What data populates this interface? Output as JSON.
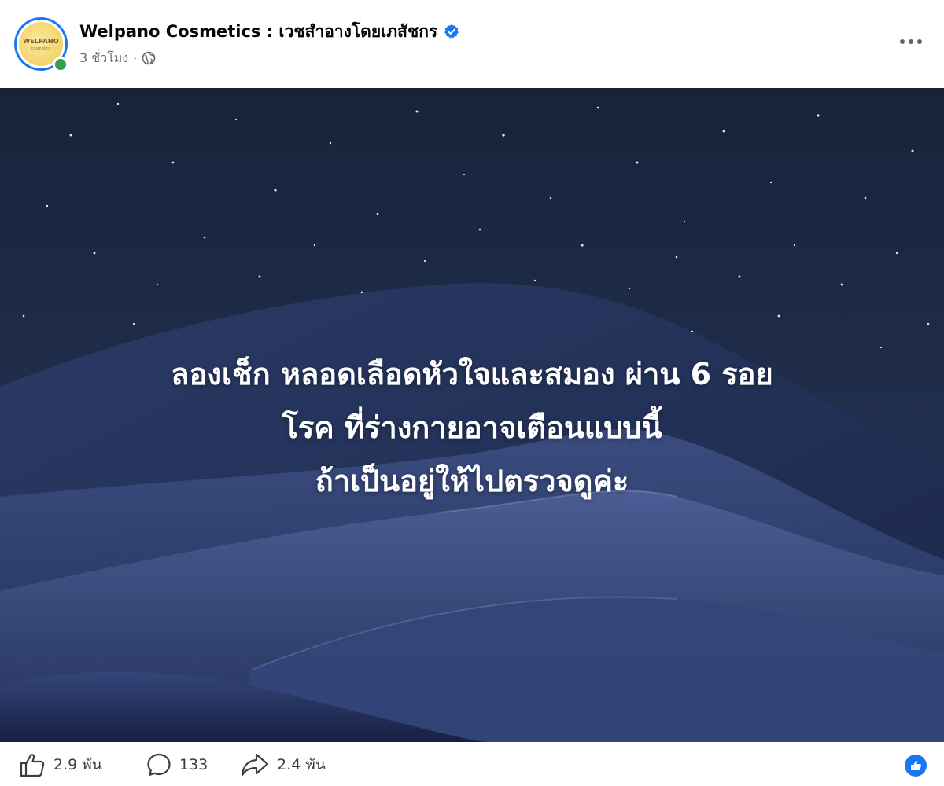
{
  "post": {
    "page_name": "Welpano Cosmetics : เวชสำอางโดยเภสัชกร",
    "avatar_text": "WELPANO",
    "avatar_subtext": "cosmetics",
    "time_ago": "3 ชั่วโมง",
    "meta_separator": "·",
    "privacy_icon": "globe-icon",
    "verified_icon": "verified-badge-icon",
    "more_icon": "more-horizontal-icon"
  },
  "image": {
    "overlay_lines": [
      "ลองเช็ก หลอดเลือดหัวใจและสมอง ผ่าน 6 รอย",
      "โรค ที่ร่างกายอาจเตือนแบบนี้",
      "ถ้าเป็นอยู่ให้ไปตรวจดูค่ะ"
    ],
    "description": "night sky over sand dunes"
  },
  "footer": {
    "likes": "2.9 พัน",
    "comments": "133",
    "shares": "2.4 พัน",
    "like_icon": "thumbs-up-icon",
    "comment_icon": "comment-icon",
    "share_icon": "share-icon",
    "reaction_icon": "like-reaction-icon"
  },
  "colors": {
    "accent": "#1877f2",
    "online": "#31a24c",
    "meta_text": "#65676b"
  }
}
